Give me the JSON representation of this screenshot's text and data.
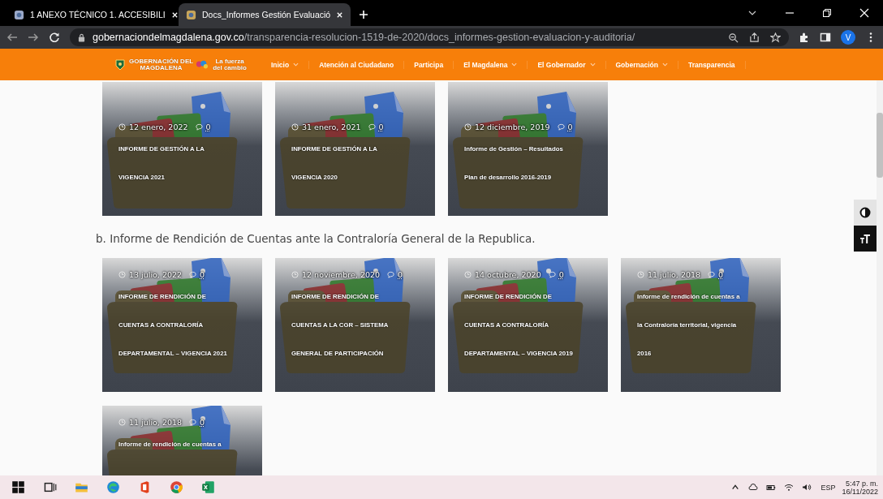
{
  "browser": {
    "tabs": [
      {
        "title": "1 ANEXO TÉCNICO 1. ACCESIBILI",
        "selected": false
      },
      {
        "title": "Docs_Informes Gestión Evaluació",
        "selected": true
      }
    ],
    "url_host": "gobernaciondelmagdalena.gov.co",
    "url_path": "/transparencia-resolucion-1519-de-2020/docs_informes-gestion-evaluacion-y-auditoria/",
    "profile_initial": "V"
  },
  "site_nav": {
    "logo_lines": [
      "GOBERNACIÓN DEL",
      "MAGDALENA"
    ],
    "slogan_lines": [
      "La fuerza",
      "del cambio"
    ],
    "items": [
      {
        "label": "Inicio",
        "has_submenu": true
      },
      {
        "label": "Atención al Ciudadano",
        "has_submenu": false
      },
      {
        "label": "Participa",
        "has_submenu": false
      },
      {
        "label": "El Magdalena",
        "has_submenu": true
      },
      {
        "label": "El Gobernador",
        "has_submenu": true
      },
      {
        "label": "Gobernación",
        "has_submenu": true
      },
      {
        "label": "Transparencia",
        "has_submenu": false
      }
    ]
  },
  "sections": [
    {
      "cards": [
        {
          "date": "12 enero, 2022",
          "comments": "0",
          "title_lines": [
            "INFORME DE GESTIÓN A LA",
            "VIGENCIA 2021"
          ]
        },
        {
          "date": "31 enero, 2021",
          "comments": "0",
          "title_lines": [
            "INFORME DE GESTIÓN A LA",
            "VIGENCIA 2020"
          ]
        },
        {
          "date": "12 diciembre, 2019",
          "comments": "0",
          "title_lines": [
            "Informe de Gestión – Resultados",
            "Plan de desarrollo 2016-2019"
          ]
        }
      ]
    },
    {
      "heading": "b. Informe de Rendición de Cuentas ante la Contraloría General de la Republica.",
      "cards": [
        {
          "date": "13 julio, 2022",
          "comments": "0",
          "title_lines": [
            "INFORME DE RENDICIÓN DE",
            "CUENTAS A CONTRALORÍA",
            "DEPARTAMENTAL – VIGENCIA 2021"
          ]
        },
        {
          "date": "12 noviembre, 2020",
          "comments": "0",
          "title_lines": [
            "INFORME DE RENDICIÓN DE",
            "CUENTAS A LA CGR – SISTEMA",
            "GENERAL DE PARTICIPACIÓN"
          ]
        },
        {
          "date": "14 octubre, 2020",
          "comments": "0",
          "title_lines": [
            "INFORME DE RENDICIÓN DE",
            "CUENTAS A CONTRALORÍA",
            "DEPARTAMENTAL – VIGENCIA 2019"
          ]
        },
        {
          "date": "11 julio, 2018",
          "comments": "0",
          "title_lines": [
            "Informe de rendición de cuentas a",
            "la Contraloría territorial, vigencia",
            "2016"
          ]
        },
        {
          "date": "11 julio, 2018",
          "comments": "0",
          "title_lines": [
            "Informe de rendición de cuentas a"
          ]
        }
      ]
    }
  ],
  "taskbar": {
    "language": "ESP",
    "time": "5:47 p. m.",
    "date": "16/11/2022"
  }
}
